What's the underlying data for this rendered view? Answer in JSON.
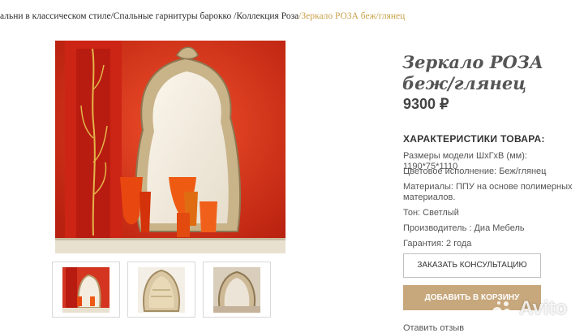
{
  "breadcrumb": {
    "items": [
      "альни в классическом стиле",
      "/Спальные гарнитуры барокко ",
      "/Коллекция Роза",
      "/Зеркало РОЗА беж/глянец"
    ]
  },
  "product": {
    "title": "Зеркало РОЗА беж/глянец",
    "price": "9300 ₽"
  },
  "specs": {
    "heading": "ХАРАКТЕРИСТИКИ ТОВАРА:",
    "items": [
      "Размеры модели ШхГхВ (мм): 1190*75*1110",
      "Цветовое исполнение: Беж/глянец",
      "Материалы: ППУ на основе полимерных материалов.",
      "Тон: Светлый",
      "Производитель : Диа Мебель",
      "Гарантия: 2 года"
    ]
  },
  "actions": {
    "consult": "ЗАКАЗАТЬ КОНСУЛЬТАЦИЮ",
    "cart": "ДОБАВИТЬ В КОРЗИНУ",
    "review": "Отавить отзыв"
  },
  "watermark": "Avito",
  "colors": {
    "accent_gold": "#c9a14a",
    "cart_button": "#c7a77c",
    "photo_red": "#d8331f"
  }
}
